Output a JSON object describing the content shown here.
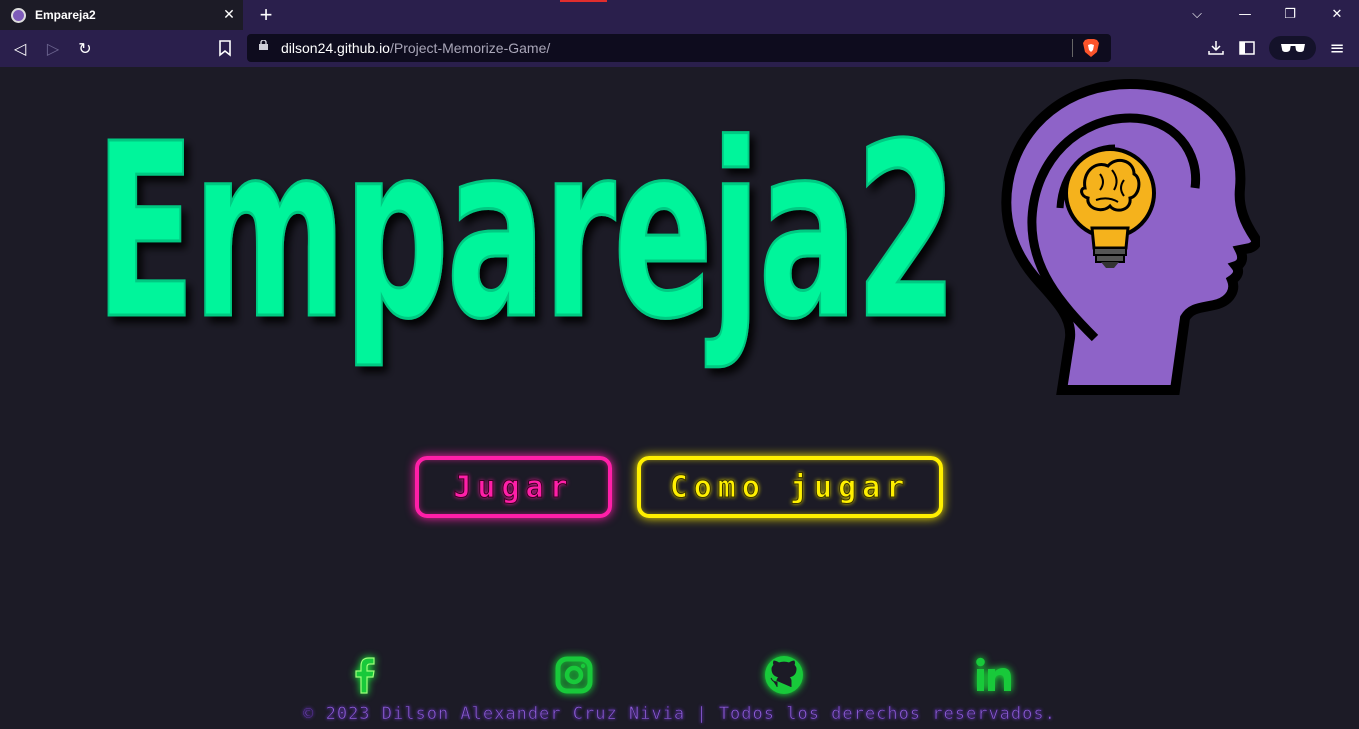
{
  "browser": {
    "tab_title": "Empareja2",
    "tab_close": "✕",
    "new_tab": "+",
    "url_host": "dilson24.github.io",
    "url_path": "/Project-Memorize-Game/",
    "window_controls": {
      "dropdown": "⌵",
      "minimize": "—",
      "restore": "❐",
      "close": "✕"
    },
    "nav": {
      "back": "◁",
      "forward": "▷",
      "reload": "↻"
    },
    "icons": [
      "bookmark-icon",
      "lock-icon",
      "brave-shields-icon",
      "download-icon",
      "sidebar-icon",
      "private-glasses-icon",
      "menu-icon"
    ],
    "glasses": "👓",
    "menu": "≡"
  },
  "page": {
    "title": "Empareja2",
    "buttons": {
      "play": "Jugar",
      "how_to_play": "Como jugar"
    },
    "social": [
      "facebook-icon",
      "instagram-icon",
      "github-icon",
      "linkedin-icon"
    ],
    "footer": "© 2023 Dilson Alexander Cruz Nivia | Todos los derechos reservados."
  },
  "colors": {
    "background": "#1c1b26",
    "browser_chrome": "#2a1f4c",
    "title_green": "#00f59b",
    "head_purple": "#8e63c8",
    "bulb_yellow": "#f5b21c",
    "play_pink": "#ff1fa8",
    "howto_yellow": "#fff000",
    "social_green": "#18ff3b",
    "footer_purple": "#8e5fd6"
  }
}
